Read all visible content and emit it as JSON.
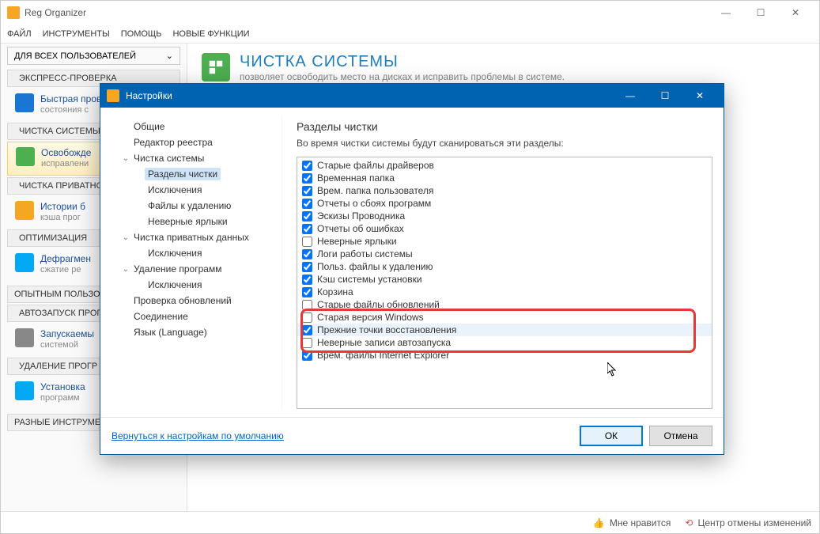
{
  "main": {
    "title": "Reg Organizer",
    "menu": [
      "ФАЙЛ",
      "ИНСТРУМЕНТЫ",
      "ПОМОЩЬ",
      "НОВЫЕ ФУНКЦИИ"
    ],
    "user_dropdown": "ДЛЯ ВСЕХ ПОЛЬЗОВАТЕЛЕЙ",
    "page_title": "ЧИСТКА СИСТЕМЫ",
    "page_sub": "позволяет освободить место на дисках и исправить проблемы в системе.",
    "status_like": "Мне нравится",
    "status_undo": "Центр отмены изменений"
  },
  "sidebar": {
    "sections": [
      {
        "label": "ЭКСПРЕСС-ПРОВЕРКА",
        "items": [
          {
            "title": "Быстрая прове",
            "sub": "состояния с",
            "icon": "#1976d2"
          }
        ]
      },
      {
        "label": "ЧИСТКА СИСТЕМЫ",
        "selected": true,
        "items": [
          {
            "title": "Освобожде",
            "sub": "исправлени",
            "icon": "#4caf50"
          }
        ]
      },
      {
        "label": "ЧИСТКА ПРИВАТНО",
        "items": [
          {
            "title": "Истории б",
            "sub": "кэша прог",
            "icon": "#f5a623"
          }
        ]
      },
      {
        "label": "ОПТИМИЗАЦИЯ",
        "items": [
          {
            "title": "Дефрагмен",
            "sub": "сжатие ре",
            "icon": "#03a9f4"
          }
        ]
      }
    ],
    "expert_label": "ОПЫТНЫМ ПОЛЬЗОВ",
    "expert_sections": [
      {
        "label": "АВТОЗАПУСК ПРОГ",
        "items": [
          {
            "title": "Запускаемы",
            "sub": "системой",
            "icon": "#888"
          }
        ]
      },
      {
        "label": "УДАЛЕНИЕ ПРОГР",
        "items": [
          {
            "title": "Установка",
            "sub": "программ",
            "icon": "#03a9f4"
          }
        ]
      }
    ],
    "misc_label": "РАЗНЫЕ ИНСТРУМЕ"
  },
  "dialog": {
    "title": "Настройки",
    "panel_title": "Разделы чистки",
    "panel_desc": "Во время чистки системы будут сканироваться эти разделы:",
    "reset_link": "Вернуться к настройкам по умолчанию",
    "ok": "ОК",
    "cancel": "Отмена",
    "tree": [
      {
        "label": "Общие",
        "lvl": 1
      },
      {
        "label": "Редактор реестра",
        "lvl": 1
      },
      {
        "label": "Чистка системы",
        "lvl": 1,
        "expander": "⌄"
      },
      {
        "label": "Разделы чистки",
        "lvl": 2,
        "selected": true
      },
      {
        "label": "Исключения",
        "lvl": 2
      },
      {
        "label": "Файлы к удалению",
        "lvl": 2
      },
      {
        "label": "Неверные ярлыки",
        "lvl": 2
      },
      {
        "label": "Чистка приватных данных",
        "lvl": 1,
        "expander": "⌄"
      },
      {
        "label": "Исключения",
        "lvl": 2
      },
      {
        "label": "Удаление программ",
        "lvl": 1,
        "expander": "⌄"
      },
      {
        "label": "Исключения",
        "lvl": 2
      },
      {
        "label": "Проверка обновлений",
        "lvl": 1
      },
      {
        "label": "Соединение",
        "lvl": 1
      },
      {
        "label": "Язык (Language)",
        "lvl": 1
      }
    ],
    "checks": [
      {
        "label": "Старые файлы драйверов",
        "checked": true
      },
      {
        "label": "Временная папка",
        "checked": true
      },
      {
        "label": "Врем. папка пользователя",
        "checked": true
      },
      {
        "label": "Отчеты о сбоях программ",
        "checked": true
      },
      {
        "label": "Эскизы Проводника",
        "checked": true
      },
      {
        "label": "Отчеты об ошибках",
        "checked": true
      },
      {
        "label": "Неверные ярлыки",
        "checked": false
      },
      {
        "label": "Логи работы системы",
        "checked": true
      },
      {
        "label": "Польз. файлы к удалению",
        "checked": true
      },
      {
        "label": "Кэш системы установки",
        "checked": true
      },
      {
        "label": "Корзина",
        "checked": true
      },
      {
        "label": "Старые файлы обновлений",
        "checked": false
      },
      {
        "label": "Старая версия Windows",
        "checked": false
      },
      {
        "label": "Прежние точки восстановления",
        "checked": true,
        "highlight": true
      },
      {
        "label": "Неверные записи автозапуска",
        "checked": false
      },
      {
        "label": "Врем. файлы Internet Explorer",
        "checked": true
      }
    ]
  }
}
